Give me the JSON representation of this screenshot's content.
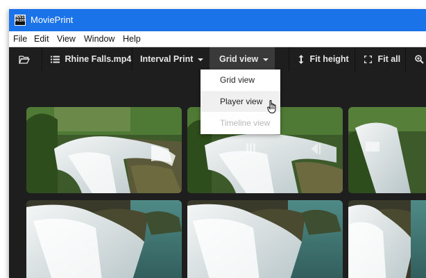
{
  "window": {
    "title": "MoviePrint",
    "logo_text": "MOVIE PRINT"
  },
  "menu": [
    "File",
    "Edit",
    "View",
    "Window",
    "Help"
  ],
  "toolbar": {
    "file_name": "Rhine Falls.mp4",
    "print_mode": "Interval Print",
    "view_mode": "Grid view",
    "fit_height": "Fit height",
    "fit_all": "Fit all"
  },
  "view_menu": {
    "items": [
      {
        "label": "Grid view",
        "state": "normal"
      },
      {
        "label": "Player view",
        "state": "hover"
      },
      {
        "label": "Timeline view",
        "state": "disabled"
      }
    ]
  },
  "thumbnail_count": 6,
  "colors": {
    "titlebar": "#1a73e8",
    "background": "#1e1e1e",
    "toolbar_active": "#3a3a3a"
  },
  "icons": {
    "open": "folder-open-icon",
    "file": "list-icon",
    "fit_height": "arrows-vertical-icon",
    "fit_all": "expand-icon",
    "zoom": "zoom-icon",
    "cursor": "hand-pointer-icon"
  }
}
